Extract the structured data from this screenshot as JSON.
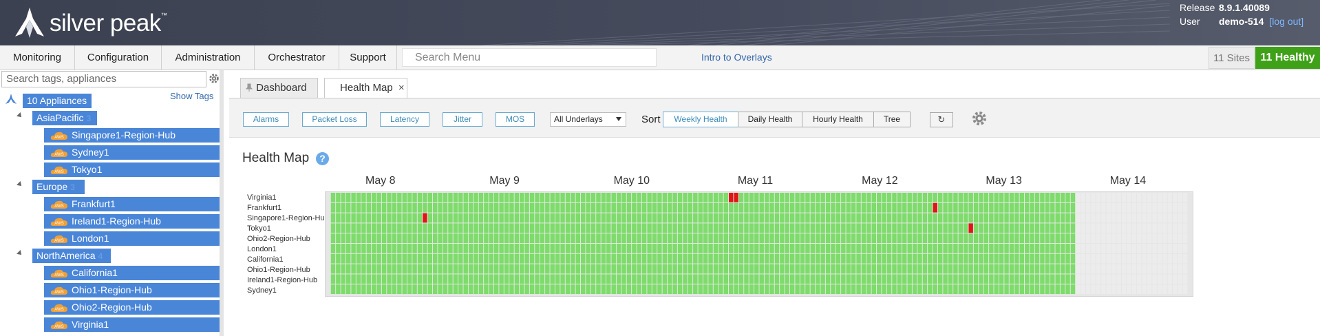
{
  "header": {
    "brand": "silver peak",
    "brand_tm": "™",
    "release_label": "Release",
    "release_value": "8.9.1.40089",
    "user_label": "User",
    "user_value": "demo-514",
    "logout_label": "[log out]"
  },
  "menu": {
    "items": [
      "Monitoring",
      "Configuration",
      "Administration",
      "Orchestrator",
      "Support"
    ],
    "search_placeholder": "Search Menu",
    "intro_link": "Intro to Overlays",
    "sites": "11 Sites",
    "healthy": "11 Healthy"
  },
  "sidebar": {
    "search_placeholder": "Search tags, appliances",
    "show_tags": "Show Tags",
    "root": "10 Appliances",
    "groups": [
      {
        "name": "AsiaPacific",
        "count": "3",
        "appliances": [
          "Singapore1-Region-Hub",
          "Sydney1",
          "Tokyo1"
        ]
      },
      {
        "name": "Europe",
        "count": "3",
        "appliances": [
          "Frankfurt1",
          "Ireland1-Region-Hub",
          "London1"
        ]
      },
      {
        "name": "NorthAmerica",
        "count": "4",
        "appliances": [
          "California1",
          "Ohio1-Region-Hub",
          "Ohio2-Region-Hub",
          "Virginia1"
        ]
      }
    ]
  },
  "tabs": [
    {
      "label": "Dashboard",
      "active": false
    },
    {
      "label": "Health Map",
      "active": true
    }
  ],
  "toolbar": {
    "filters": [
      "Alarms",
      "Packet Loss",
      "Latency",
      "Jitter",
      "MOS"
    ],
    "underlay": "All Underlays",
    "sort_label": "Sort",
    "sort_options": [
      "Weekly Health",
      "Daily Health",
      "Hourly Health",
      "Tree"
    ],
    "sort_selected": "Weekly Health"
  },
  "health_map": {
    "title": "Health Map",
    "help": "?",
    "days": [
      "May 8",
      "May 9",
      "May 10",
      "May 11",
      "May 12",
      "May 13",
      "May 14"
    ],
    "rows": [
      "Virginia1",
      "Frankfurt1",
      "Singapore1-Region-Hub",
      "Tokyo1",
      "Ohio2-Region-Hub",
      "London1",
      "California1",
      "Ohio1-Region-Hub",
      "Ireland1-Region-Hub",
      "Sydney1"
    ],
    "colors": {
      "healthy": "#7ddc6a",
      "critical": "#e01616",
      "nodata": "#ececec"
    },
    "hours_per_day": 24,
    "data_hours": 146,
    "total_hours": 168,
    "critical_cells": [
      {
        "row": "Virginia1",
        "hour": 78
      },
      {
        "row": "Virginia1",
        "hour": 79
      },
      {
        "row": "Frankfurt1",
        "hour": 118
      },
      {
        "row": "Singapore1-Region-Hub",
        "hour": 18
      },
      {
        "row": "Tokyo1",
        "hour": 125
      }
    ]
  }
}
